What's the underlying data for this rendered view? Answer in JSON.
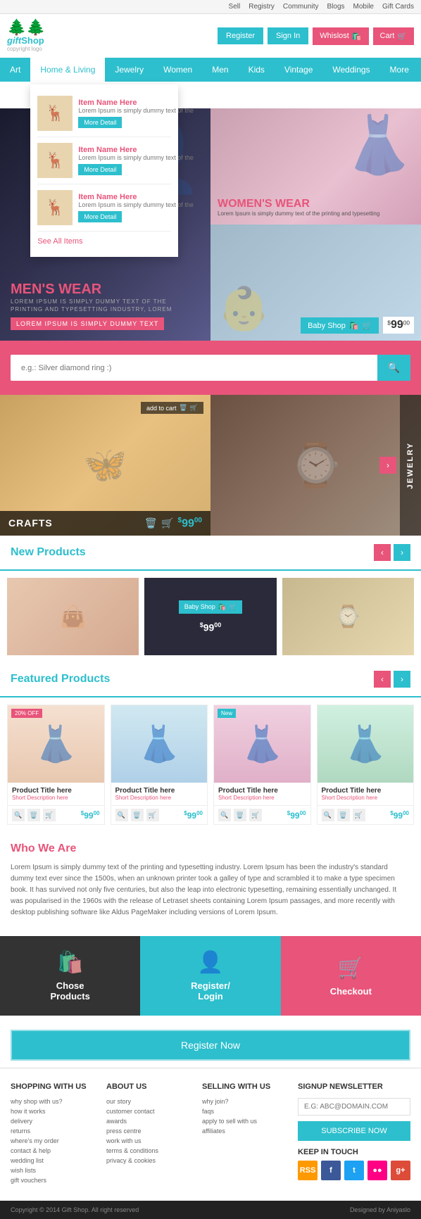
{
  "topbar": {
    "links": [
      "Sell",
      "Registry",
      "Community",
      "Blogs",
      "Mobile",
      "Gift Cards"
    ]
  },
  "header": {
    "logo_line1": "copyright logo",
    "logo_line2": "Gift Shop",
    "btn_register": "Register",
    "btn_signin": "Sign In",
    "btn_wishlist": "Whislost",
    "btn_cart": "Cart"
  },
  "nav": {
    "items": [
      "Art",
      "Home & Living",
      "Jewelry",
      "Women",
      "Men",
      "Kids",
      "Vintage",
      "Weddings",
      "More"
    ]
  },
  "dropdown": {
    "items": [
      {
        "title": "Item Name Here",
        "desc": "Lorem Ipsum is simply dummy text of the",
        "btn": "More Detail"
      },
      {
        "title": "Item Name Here",
        "desc": "Lorem Ipsum is simply dummy text of the",
        "btn": "More Detail"
      },
      {
        "title": "Item Name Here",
        "desc": "Lorem Ipsum is simply dummy text of the",
        "btn": "More Detail"
      }
    ],
    "see_all": "See All Items"
  },
  "hero": {
    "mens": {
      "title": "MEN'S WEAR",
      "subtitle": "LOREM IPSUM IS SIMPLY DUMMY TEXT OF THE PRINTING AND TYPESETTING INDUSTRY, LOREM",
      "tag": "LOREM IPSUM IS SIMPLY DUMMY TEXT"
    },
    "womens": {
      "title": "WOMEN'S WEAR",
      "desc": "Lorem Ipsum is simply dummy text of the printing and typesetting"
    },
    "baby": {
      "btn": "Baby Shop",
      "price": "$99",
      "price_cents": "00"
    }
  },
  "search": {
    "placeholder": "e.g.: Silver diamond ring :)",
    "btn_icon": "🔍"
  },
  "showcase": {
    "crafts": {
      "label": "CRAFTS",
      "add_to_cart": "add to cart",
      "price": "$99",
      "price_cents": "00"
    },
    "jewelry": {
      "label": "JEWELRY"
    }
  },
  "new_products": {
    "title": "New Products",
    "baby_btn": "Baby Shop",
    "baby_price": "$99",
    "baby_price_cents": "00"
  },
  "featured_products": {
    "title": "Featured Products",
    "items": [
      {
        "badge": "20% OFF",
        "badge_type": "sale",
        "title": "Product Title here",
        "desc": "Short Description here",
        "price": "$99",
        "price_cents": "00"
      },
      {
        "badge": "",
        "badge_type": "",
        "title": "Product Title here",
        "desc": "Short Description here",
        "price": "$99",
        "price_cents": "00"
      },
      {
        "badge": "New",
        "badge_type": "new",
        "title": "Product Title here",
        "desc": "Short Description here",
        "price": "$99",
        "price_cents": "00"
      },
      {
        "badge": "",
        "badge_type": "",
        "title": "Product Title here",
        "desc": "Short Description here",
        "price": "$99",
        "price_cents": "00"
      }
    ]
  },
  "who_we_are": {
    "title": "Who We Are",
    "text": "Lorem Ipsum is simply dummy text of the printing and typesetting industry. Lorem Ipsum has been the industry's standard dummy text ever since the 1500s, when an unknown printer took a galley of type and scrambled it to make a type specimen book. It has survived not only five centuries, but also the leap into electronic typesetting, remaining essentially unchanged. It was popularised in the 1960s with the release of Letraset sheets containing Lorem Ipsum passages, and more recently with desktop publishing software like Aldus PageMaker including versions of Lorem Ipsum."
  },
  "steps": [
    {
      "icon": "🛍️",
      "text": "Chose\nProducts",
      "style": "dark"
    },
    {
      "icon": "👤",
      "text": "Register/\nLogin",
      "style": "teal"
    },
    {
      "icon": "🛒",
      "text": "Checkout",
      "style": "pink"
    }
  ],
  "register_now": {
    "label": "Register Now"
  },
  "footer": {
    "col1": {
      "title": "SHOPPING WITH US",
      "links": [
        "why shop with us?",
        "how it works",
        "delivery",
        "returns",
        "where's my order",
        "contact & help",
        "wedding list",
        "wish lists",
        "gift vouchers"
      ]
    },
    "col2": {
      "title": "ABOUT US",
      "links": [
        "our story",
        "customer contact",
        "awards",
        "press centre",
        "work with us",
        "terms & conditions",
        "privacy & cookies"
      ]
    },
    "col3": {
      "title": "SELLING WITH US",
      "links": [
        "why join?",
        "faqs",
        "apply to sell with us",
        "affiliates"
      ]
    },
    "col4": {
      "title": "SIGNUP NEWSLETTER",
      "input_placeholder": "E.G: ABC@DOMAIN.COM",
      "subscribe_btn": "SUBSCRIBE NOW",
      "keep_in_touch": "KEEP IN TOUCH"
    }
  },
  "copyright": {
    "left": "Copyright © 2014 Gift Shop. All right reserved",
    "right": "Designed by Aniyaslo"
  }
}
